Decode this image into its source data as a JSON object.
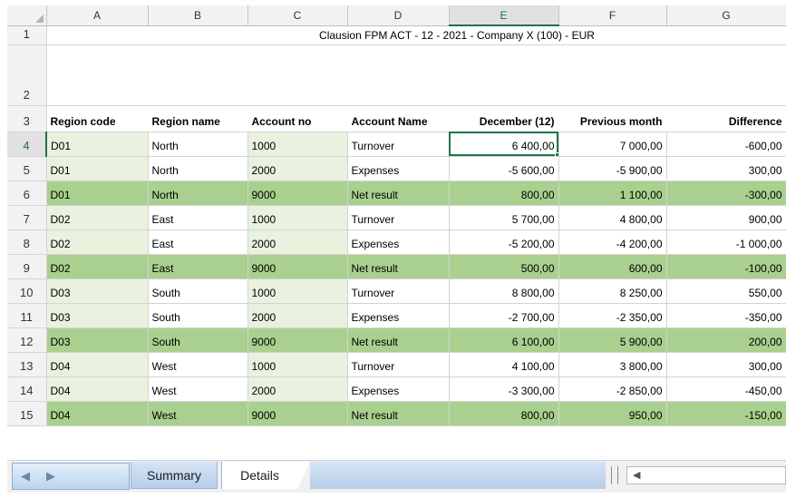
{
  "columns": [
    "A",
    "B",
    "C",
    "D",
    "E",
    "F",
    "G"
  ],
  "title": {
    "row_label": "1",
    "text": "Clausion FPM    ACT - 12 - 2021 - Company X (100) - EUR"
  },
  "blank_row_label": "2",
  "header_row": {
    "row_label": "3",
    "cells": [
      "Region code",
      "Region name",
      "Account no",
      "Account Name",
      "December (12)",
      "Previous month",
      "Difference"
    ]
  },
  "rows": [
    {
      "n": "4",
      "code": "D01",
      "name": "North",
      "acc": "1000",
      "accname": "Turnover",
      "dec": "6 400,00",
      "prev": "7 000,00",
      "diff": "-600,00"
    },
    {
      "n": "5",
      "code": "D01",
      "name": "North",
      "acc": "2000",
      "accname": "Expenses",
      "dec": "-5 600,00",
      "prev": "-5 900,00",
      "diff": "300,00"
    },
    {
      "n": "6",
      "code": "D01",
      "name": "North",
      "acc": "9000",
      "accname": "Net result",
      "dec": "800,00",
      "prev": "1 100,00",
      "diff": "-300,00"
    },
    {
      "n": "7",
      "code": "D02",
      "name": "East",
      "acc": "1000",
      "accname": "Turnover",
      "dec": "5 700,00",
      "prev": "4 800,00",
      "diff": "900,00"
    },
    {
      "n": "8",
      "code": "D02",
      "name": "East",
      "acc": "2000",
      "accname": "Expenses",
      "dec": "-5 200,00",
      "prev": "-4 200,00",
      "diff": "-1 000,00"
    },
    {
      "n": "9",
      "code": "D02",
      "name": "East",
      "acc": "9000",
      "accname": "Net result",
      "dec": "500,00",
      "prev": "600,00",
      "diff": "-100,00"
    },
    {
      "n": "10",
      "code": "D03",
      "name": "South",
      "acc": "1000",
      "accname": "Turnover",
      "dec": "8 800,00",
      "prev": "8 250,00",
      "diff": "550,00"
    },
    {
      "n": "11",
      "code": "D03",
      "name": "South",
      "acc": "2000",
      "accname": "Expenses",
      "dec": "-2 700,00",
      "prev": "-2 350,00",
      "diff": "-350,00"
    },
    {
      "n": "12",
      "code": "D03",
      "name": "South",
      "acc": "9000",
      "accname": "Net result",
      "dec": "6 100,00",
      "prev": "5 900,00",
      "diff": "200,00"
    },
    {
      "n": "13",
      "code": "D04",
      "name": "West",
      "acc": "1000",
      "accname": "Turnover",
      "dec": "4 100,00",
      "prev": "3 800,00",
      "diff": "300,00"
    },
    {
      "n": "14",
      "code": "D04",
      "name": "West",
      "acc": "2000",
      "accname": "Expenses",
      "dec": "-3 300,00",
      "prev": "-2 850,00",
      "diff": "-450,00"
    },
    {
      "n": "15",
      "code": "D04",
      "name": "West",
      "acc": "9000",
      "accname": "Net result",
      "dec": "800,00",
      "prev": "950,00",
      "diff": "-150,00"
    }
  ],
  "sheet_tabs": [
    "Summary",
    "Details"
  ],
  "active_tab": "Details",
  "selected_cell": "E4",
  "colors": {
    "net_result_row": "#a9d08e",
    "id_column_tint": "#e8f2df",
    "selection": "#217346"
  },
  "icons": {
    "nav_prev": "◀",
    "nav_next": "▶",
    "scroll_left": "◀"
  }
}
